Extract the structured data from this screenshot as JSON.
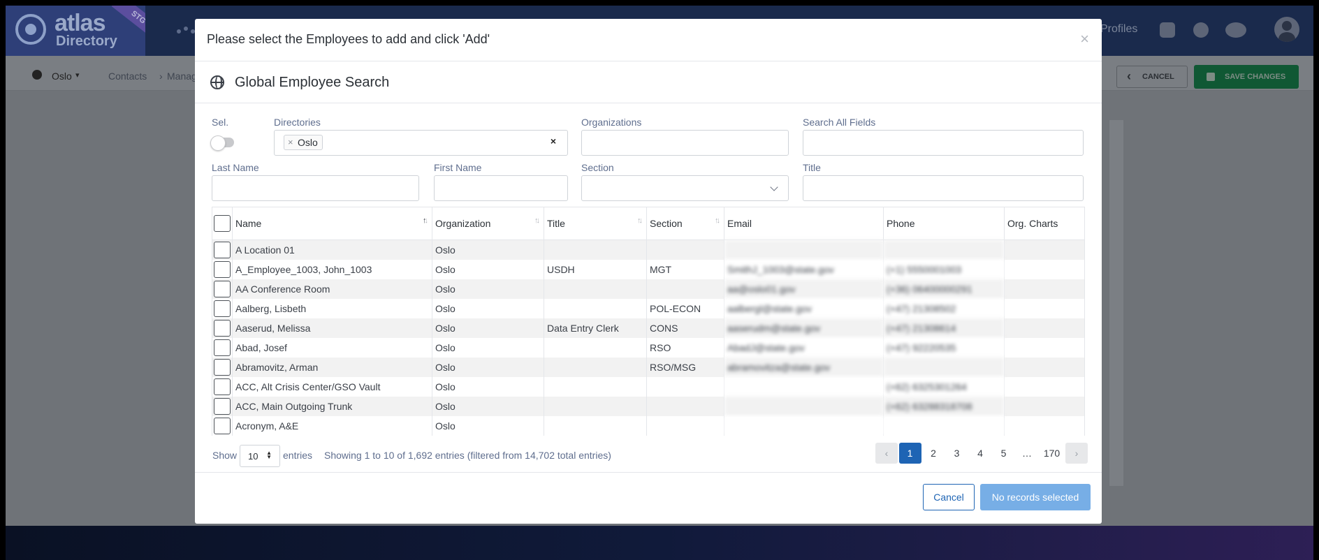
{
  "app": {
    "logo_main": "atlas",
    "logo_sub": "Directory",
    "env_badge": "STG",
    "profiles_label": "Profiles",
    "location": "Oslo",
    "breadcrumb": [
      "Contacts",
      "Manag"
    ],
    "cancel_label": "CANCEL",
    "save_label": "SAVE CHANGES"
  },
  "modal": {
    "title": "Please select the Employees to add and click 'Add'",
    "close_icon": "×",
    "subtitle": "Global Employee Search",
    "filters": {
      "sel_label": "Sel.",
      "directories_label": "Directories",
      "directory_tag": "Oslo",
      "organizations_label": "Organizations",
      "search_all_label": "Search All Fields",
      "last_name_label": "Last Name",
      "first_name_label": "First Name",
      "section_label": "Section",
      "title_label": "Title"
    },
    "table": {
      "columns": [
        "Name",
        "Organization",
        "Title",
        "Section",
        "Email",
        "Phone",
        "Org. Charts"
      ],
      "rows": [
        {
          "name": "A Location 01",
          "org": "Oslo",
          "title": "",
          "section": "",
          "email": "",
          "phone": ""
        },
        {
          "name": "A_Employee_1003, John_1003",
          "org": "Oslo",
          "title": "USDH",
          "section": "MGT",
          "email": "SmithJ_1003@state.gov",
          "phone": "(+1) 5550001003"
        },
        {
          "name": "AA Conference Room",
          "org": "Oslo",
          "title": "",
          "section": "",
          "email": "aa@oslo01.gov",
          "phone": "(+36) 06400000291"
        },
        {
          "name": "Aalberg, Lisbeth",
          "org": "Oslo",
          "title": "",
          "section": "POL-ECON",
          "email": "aalbergl@state.gov",
          "phone": "(+47) 21308502"
        },
        {
          "name": "Aaserud, Melissa",
          "org": "Oslo",
          "title": "Data Entry Clerk",
          "section": "CONS",
          "email": "aaserudm@state.gov",
          "phone": "(+47) 21308614"
        },
        {
          "name": "Abad, Josef",
          "org": "Oslo",
          "title": "",
          "section": "RSO",
          "email": "AbadJ@state.gov",
          "phone": "(+47) 92220535"
        },
        {
          "name": "Abramovitz, Arman",
          "org": "Oslo",
          "title": "",
          "section": "RSO/MSG",
          "email": "abramovitza@state.gov",
          "phone": ""
        },
        {
          "name": "ACC, Alt Crisis Center/GSO Vault",
          "org": "Oslo",
          "title": "",
          "section": "",
          "email": "",
          "phone": "(+62) 6325301264"
        },
        {
          "name": "ACC, Main Outgoing Trunk",
          "org": "Oslo",
          "title": "",
          "section": "",
          "email": "",
          "phone": "(+62) 63288318708"
        },
        {
          "name": "Acronym, A&E",
          "org": "Oslo",
          "title": "",
          "section": "",
          "email": "",
          "phone": ""
        }
      ]
    },
    "pagination": {
      "show_label": "Show",
      "page_size": "10",
      "entries_label": "entries",
      "info": "Showing 1 to 10 of 1,692 entries (filtered from 14,702 total entries)",
      "pages": [
        "1",
        "2",
        "3",
        "4",
        "5",
        "…",
        "170"
      ],
      "prev": "‹",
      "next": "›"
    },
    "cancel_button": "Cancel",
    "add_button": "No records selected"
  }
}
